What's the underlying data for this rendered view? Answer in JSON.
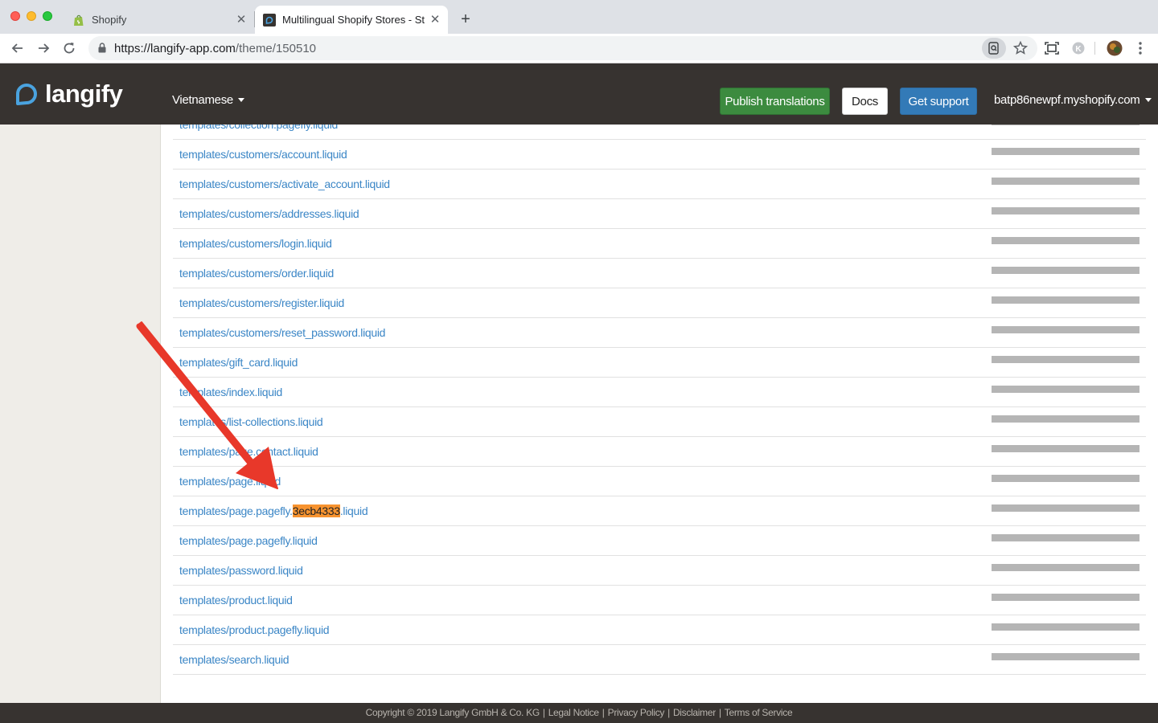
{
  "browser": {
    "tabs": [
      {
        "title": "Shopify",
        "favicon": "shopify-bag-icon",
        "active": false
      },
      {
        "title": "Multilingual Shopify Stores - St",
        "favicon": "langify-icon",
        "active": true
      }
    ],
    "url_host": "https://langify-app.com",
    "url_path": "/theme/150510"
  },
  "header": {
    "logo_text": "langify",
    "language": "Vietnamese",
    "publish_label": "Publish translations",
    "docs_label": "Docs",
    "support_label": "Get support",
    "shop": "batp86newpf.myshopify.com"
  },
  "files": [
    {
      "pre": "templates/collection.pagefly.liquid",
      "hl": "",
      "post": ""
    },
    {
      "pre": "templates/customers/account.liquid",
      "hl": "",
      "post": ""
    },
    {
      "pre": "templates/customers/activate_account.liquid",
      "hl": "",
      "post": ""
    },
    {
      "pre": "templates/customers/addresses.liquid",
      "hl": "",
      "post": ""
    },
    {
      "pre": "templates/customers/login.liquid",
      "hl": "",
      "post": ""
    },
    {
      "pre": "templates/customers/order.liquid",
      "hl": "",
      "post": ""
    },
    {
      "pre": "templates/customers/register.liquid",
      "hl": "",
      "post": ""
    },
    {
      "pre": "templates/customers/reset_password.liquid",
      "hl": "",
      "post": ""
    },
    {
      "pre": "templates/gift_card.liquid",
      "hl": "",
      "post": ""
    },
    {
      "pre": "templates/index.liquid",
      "hl": "",
      "post": ""
    },
    {
      "pre": "templates/list-collections.liquid",
      "hl": "",
      "post": ""
    },
    {
      "pre": "templates/page.contact.liquid",
      "hl": "",
      "post": ""
    },
    {
      "pre": "templates/page.liquid",
      "hl": "",
      "post": ""
    },
    {
      "pre": "templates/page.pagefly.",
      "hl": "3ecb4333",
      "post": ".liquid"
    },
    {
      "pre": "templates/page.pagefly.liquid",
      "hl": "",
      "post": ""
    },
    {
      "pre": "templates/password.liquid",
      "hl": "",
      "post": ""
    },
    {
      "pre": "templates/product.liquid",
      "hl": "",
      "post": ""
    },
    {
      "pre": "templates/product.pagefly.liquid",
      "hl": "",
      "post": ""
    },
    {
      "pre": "templates/search.liquid",
      "hl": "",
      "post": ""
    }
  ],
  "footer": {
    "copyright": "Copyright © 2019 Langify GmbH & Co. KG",
    "links": [
      "Legal Notice",
      "Privacy Policy",
      "Disclaimer",
      "Terms of Service"
    ]
  },
  "colors": {
    "header_bg": "#373330",
    "publish_green": "#3c8b3f",
    "support_blue": "#337ab7",
    "link_blue": "#3b86c6",
    "highlight_orange": "#f7932f",
    "annotation_red": "#e8382a"
  }
}
